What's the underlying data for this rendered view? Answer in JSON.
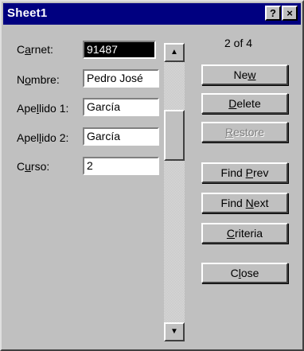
{
  "window": {
    "title": "Sheet1",
    "help_glyph": "?",
    "close_glyph": "×"
  },
  "fields": [
    {
      "label_pre": "C",
      "label_key": "a",
      "label_post": "rnet:",
      "value": "91487"
    },
    {
      "label_pre": "N",
      "label_key": "o",
      "label_post": "mbre:",
      "value": "Pedro José"
    },
    {
      "label_pre": "Ape",
      "label_key": "l",
      "label_post": "lido 1:",
      "value": "García"
    },
    {
      "label_pre": "Apel",
      "label_key": "l",
      "label_post": "ido 2:",
      "value": "García"
    },
    {
      "label_pre": "C",
      "label_key": "u",
      "label_post": "rso:",
      "value": "2"
    }
  ],
  "record_counter": "2 of 4",
  "scrollbar": {
    "up_glyph": "▲",
    "down_glyph": "▼"
  },
  "buttons": {
    "new": {
      "pre": "Ne",
      "key": "w",
      "post": ""
    },
    "delete": {
      "pre": "",
      "key": "D",
      "post": "elete"
    },
    "restore": {
      "pre": "",
      "key": "R",
      "post": "estore",
      "enabled": false
    },
    "find_prev": {
      "pre": "Find ",
      "key": "P",
      "post": "rev"
    },
    "find_next": {
      "pre": "Find ",
      "key": "N",
      "post": "ext"
    },
    "criteria": {
      "pre": "",
      "key": "C",
      "post": "riteria"
    },
    "close": {
      "pre": "C",
      "key": "l",
      "post": "ose"
    }
  }
}
